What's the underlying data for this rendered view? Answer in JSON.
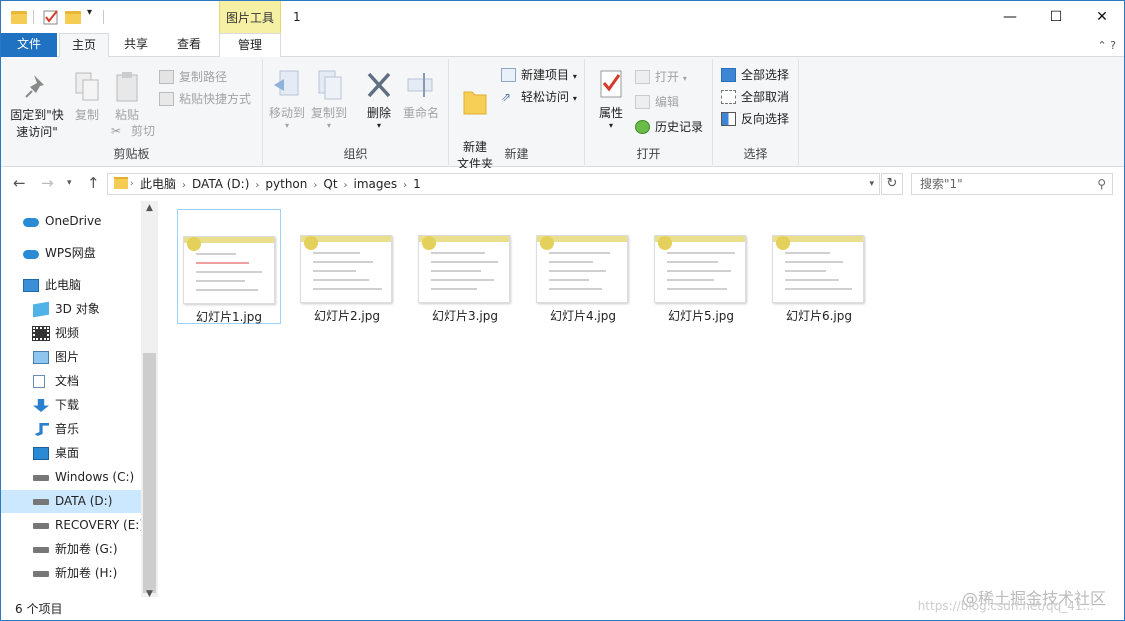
{
  "titlebar": {
    "tool_tab": "图片工具",
    "title": "1",
    "minimize": "—",
    "maximize": "☐",
    "close": "✕"
  },
  "tabs": {
    "file": "文件",
    "home": "主页",
    "share": "共享",
    "view": "查看",
    "manage": "管理",
    "right_icons": "⌃ ?"
  },
  "ribbon": {
    "clipboard": {
      "label": "剪贴板",
      "pin": "固定到\"快速访问\"",
      "copy": "复制",
      "paste": "粘贴",
      "copy_path": "复制路径",
      "paste_shortcut": "粘贴快捷方式",
      "cut": "剪切"
    },
    "organize": {
      "label": "组织",
      "move_to": "移动到",
      "copy_to": "复制到",
      "delete": "删除",
      "rename": "重命名"
    },
    "new": {
      "label": "新建",
      "new_folder": "新建\n文件夹",
      "new_item": "新建项目",
      "easy_access": "轻松访问"
    },
    "open": {
      "label": "打开",
      "properties": "属性",
      "open": "打开",
      "edit": "编辑",
      "history": "历史记录"
    },
    "select": {
      "label": "选择",
      "select_all": "全部选择",
      "select_none": "全部取消",
      "invert": "反向选择"
    }
  },
  "address": {
    "crumbs": [
      "此电脑",
      "DATA (D:)",
      "python",
      "Qt",
      "images",
      "1"
    ],
    "search_placeholder": "搜索\"1\""
  },
  "nav": {
    "items": [
      {
        "label": "OneDrive",
        "icon": "cloud-icon"
      },
      {
        "label": "WPS网盘",
        "icon": "cloud-icon"
      },
      {
        "label": "此电脑",
        "icon": "computer-icon"
      },
      {
        "label": "3D 对象",
        "icon": "cube-icon"
      },
      {
        "label": "视频",
        "icon": "film-icon"
      },
      {
        "label": "图片",
        "icon": "picture-icon"
      },
      {
        "label": "文档",
        "icon": "document-icon"
      },
      {
        "label": "下载",
        "icon": "download-icon"
      },
      {
        "label": "音乐",
        "icon": "music-icon"
      },
      {
        "label": "桌面",
        "icon": "desktop-icon"
      },
      {
        "label": "Windows (C:)",
        "icon": "drive-icon"
      },
      {
        "label": "DATA (D:)",
        "icon": "drive-icon"
      },
      {
        "label": "RECOVERY (E:)",
        "icon": "drive-icon"
      },
      {
        "label": "新加卷 (G:)",
        "icon": "drive-icon"
      },
      {
        "label": "新加卷 (H:)",
        "icon": "drive-icon"
      }
    ]
  },
  "files": [
    "幻灯片1.jpg",
    "幻灯片2.jpg",
    "幻灯片3.jpg",
    "幻灯片4.jpg",
    "幻灯片5.jpg",
    "幻灯片6.jpg"
  ],
  "status": {
    "count": "6 个项目"
  },
  "watermark": {
    "line1": "@稀土掘金技术社区",
    "line2": "https://blog.csdn.net/qq_41..."
  },
  "colors": {
    "accent": "#1e72c1",
    "selection": "#cce8ff",
    "tool_tab": "#f5f0a4"
  }
}
